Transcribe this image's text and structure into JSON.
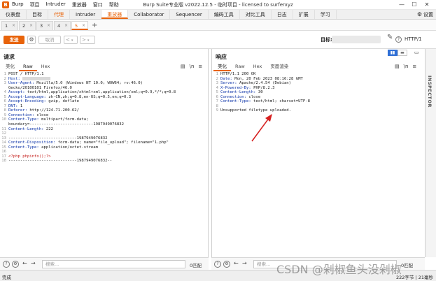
{
  "app": {
    "menus": [
      "Burp",
      "项目",
      "Intruder",
      "重放器",
      "窗口",
      "帮助"
    ],
    "window_title": "Burp Suite专业版  v2022.12.5 - 临时项目 - licensed to surferxyz",
    "logo": "burp-logo"
  },
  "tool_tabs": [
    "仪表盘",
    "目标",
    "代理",
    "Intruder",
    "重放器",
    "Collaborator",
    "Sequencer",
    "编码工具",
    "对比工具",
    "日志",
    "扩展",
    "学习"
  ],
  "active_tool_tab": "重放器",
  "settings_label": "设置",
  "request_tabs": [
    {
      "label": "1",
      "close": "×"
    },
    {
      "label": "2",
      "close": "×"
    },
    {
      "label": "3",
      "close": "×"
    },
    {
      "label": "4",
      "close": "×"
    },
    {
      "label": "5",
      "close": "×"
    }
  ],
  "add_tab": "+",
  "toolbar": {
    "send": "发送",
    "cancel": "取消",
    "back": "<",
    "forward": ">",
    "dropdown_arrow": "▾",
    "target_label": "目标:",
    "http_version": "HTTP/1"
  },
  "request": {
    "title": "请求",
    "tabs": [
      "美化",
      "Raw",
      "Hex"
    ],
    "active_tab": "Raw",
    "lines": [
      {
        "n": "1",
        "k": "",
        "v": "POST / HTTP/1.1"
      },
      {
        "n": "2",
        "k": "Host: ",
        "v": ""
      },
      {
        "n": "3",
        "k": "User-Agent: ",
        "v": "Mozilla/5.0 (Windows NT 10.0; WOW64; rv:46.0)"
      },
      {
        "n": "",
        "k": "",
        "v": "Gecko/20100101 Firefox/46.0"
      },
      {
        "n": "4",
        "k": "Accept: ",
        "v": "text/html,application/xhtml+xml,application/xml;q=0.9,*/*;q=0.8"
      },
      {
        "n": "5",
        "k": "Accept-Language: ",
        "v": "zh-CN,zh;q=0.8,en-US;q=0.5,en;q=0.3"
      },
      {
        "n": "6",
        "k": "Accept-Encoding: ",
        "v": "gzip, deflate"
      },
      {
        "n": "7",
        "k": "DNT: ",
        "v": "1"
      },
      {
        "n": "8",
        "k": "Referer: ",
        "v": "http://124.71.200.62/"
      },
      {
        "n": "9",
        "k": "Connection: ",
        "v": "close"
      },
      {
        "n": "10",
        "k": "Content-Type: ",
        "v": "multipart/form-data;"
      },
      {
        "n": "",
        "k": "",
        "v": "boundary=---------------------------1987949076832"
      },
      {
        "n": "11",
        "k": "Content-Length: ",
        "v": "222"
      },
      {
        "n": "12",
        "k": "",
        "v": ""
      },
      {
        "n": "13",
        "k": "",
        "v": "-----------------------------1987949076832"
      },
      {
        "n": "14",
        "k": "Content-Disposition: ",
        "v": "form-data; name=\"file_upload\"; filename=\"1.php\""
      },
      {
        "n": "15",
        "k": "Content-Type: ",
        "v": "application/octet-stream"
      },
      {
        "n": "16",
        "k": "",
        "v": ""
      },
      {
        "n": "17",
        "k": "",
        "v": "<?php phpinfo();?>",
        "s": true
      },
      {
        "n": "18",
        "k": "",
        "v": "-----------------------------1987949076832--"
      }
    ]
  },
  "response": {
    "title": "响应",
    "tabs": [
      "美化",
      "Raw",
      "Hex",
      "页面渲染"
    ],
    "active_tab": "美化",
    "lines": [
      {
        "n": "1",
        "k": "",
        "v": "HTTP/1.1 200 OK"
      },
      {
        "n": "2",
        "k": "Date: ",
        "v": "Mon, 20 Feb 2023 08:16:28 GMT"
      },
      {
        "n": "3",
        "k": "Server: ",
        "v": "Apache/2.4.54 (Debian)"
      },
      {
        "n": "4",
        "k": "X-Powered-By: ",
        "v": "PHP/8.2.3"
      },
      {
        "n": "5",
        "k": "Content-Length: ",
        "v": "30"
      },
      {
        "n": "6",
        "k": "Connection: ",
        "v": "close"
      },
      {
        "n": "7",
        "k": "Content-Type: ",
        "v": "text/html; charset=UTF-8"
      },
      {
        "n": "8",
        "k": "",
        "v": ""
      },
      {
        "n": "9",
        "k": "",
        "v": "Unsupported filetype uploaded."
      }
    ]
  },
  "inspector_label": "INSPECTOR",
  "search": {
    "placeholder": "搜索...",
    "left_count": "0匹配",
    "right_count": "0匹配"
  },
  "status": {
    "left": "完成",
    "right": "222字节 | 21毫秒"
  },
  "watermark": "CSDN @剁椒鱼头没剁椒",
  "colors": {
    "accent": "#e8630a",
    "header_key": "#0c33a8",
    "string": "#c41a16",
    "toggle_on": "#2f6fd6"
  }
}
